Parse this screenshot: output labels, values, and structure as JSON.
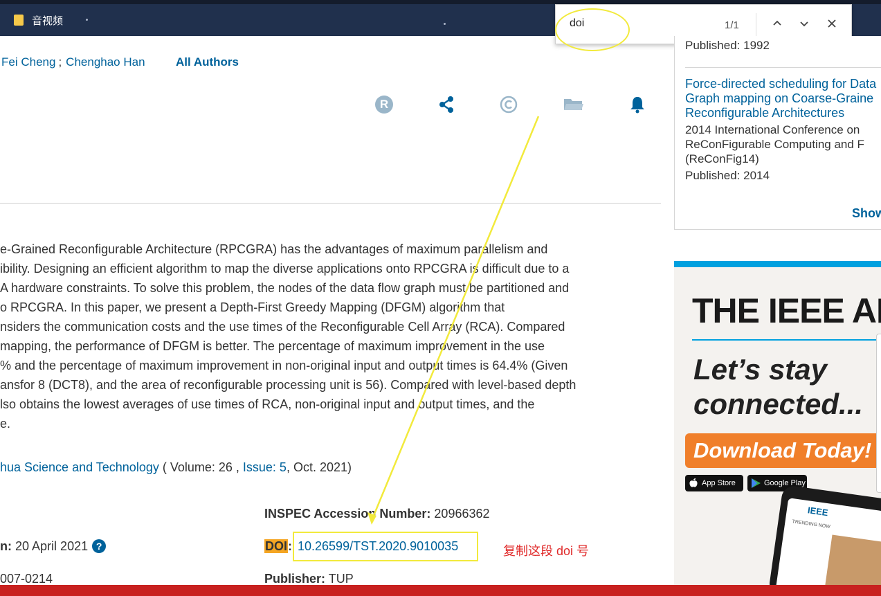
{
  "bookmarks": {
    "folder_label": "音视频"
  },
  "find_bar": {
    "query": "doi",
    "count": "1/1",
    "prev_glyph": "⌃",
    "next_glyph": "⌄",
    "close_glyph": "✕"
  },
  "authors": {
    "names": [
      "Fei Cheng",
      "Chenghao Han"
    ],
    "separator": ";",
    "all_authors_label": "All Authors"
  },
  "action_icons": [
    "rights-icon",
    "share-icon",
    "copyright-icon",
    "folder-icon",
    "bell-icon"
  ],
  "abstract": {
    "lines": [
      "e-Grained Reconfigurable Architecture (RPCGRA) has the advantages of maximum parallelism and",
      "ibility. Designing an efficient algorithm to map the diverse applications onto RPCGRA is difficult due to a",
      "A hardware constraints. To solve this problem, the nodes of the data flow graph must be partitioned and",
      "o RPCGRA. In this paper, we present a Depth-First Greedy Mapping (DFGM) algorithm that",
      "nsiders the communication costs and the use times of the Reconfigurable Cell Array (RCA). Compared",
      "mapping, the performance of DFGM is better. The percentage of maximum improvement in the use",
      "% and the percentage of maximum improvement in non-original input and output times is 64.4% (Given",
      "ansfor 8 (DCT8), and the area of reconfigurable processing unit is 56). Compared with level-based depth",
      "lso obtains the lowest averages of use times of RCA, non-original input and output times, and the",
      "e."
    ]
  },
  "publication": {
    "journal": "hua Science and Technology",
    "open_paren": " ( Volume: 26 , ",
    "issue": "Issue: 5",
    "date": ", Oct. 2021)"
  },
  "metadata": {
    "inspec_label": "INSPEC Accession Number:",
    "inspec_value": "20966362",
    "pubdate_label": "n:",
    "pubdate_value": "20 April 2021",
    "help_glyph": "?",
    "doi_label": "DOI",
    "doi_colon": ":",
    "doi_value": "10.26599/TST.2020.9010035",
    "issn_fragment": "007-0214",
    "publisher_label": "Publisher:",
    "publisher_value": "TUP"
  },
  "annotation": {
    "note": "复制这段 doi 号",
    "highlight_color": "#f2ea3c",
    "note_color": "#e02a2a"
  },
  "sidebar": {
    "first_published": "Published: 1992",
    "article_title_lines": [
      "Force-directed scheduling for Data",
      "Graph mapping on Coarse-Graine",
      "Reconfigurable Architectures"
    ],
    "conference_lines": [
      "2014 International Conference on",
      "ReConFigurable Computing and F",
      "(ReConFig14)"
    ],
    "published": "Published: 2014",
    "show_more": "Show"
  },
  "ad": {
    "headline": "THE IEEE AP",
    "line1": "Let’s stay",
    "line2": "connected...",
    "button": "Download Today!",
    "app_store": "App Store",
    "google_play": "Google Play",
    "phone_brand": "IEEE",
    "phone_section": "TRENDING NOW"
  },
  "colors": {
    "link": "#00629b",
    "topbar": "#20304d",
    "bottom_bar": "#c8211f",
    "doi_highlight": "#f5a623",
    "ad_accent": "#00a0df",
    "ad_button": "#f07f2a"
  }
}
